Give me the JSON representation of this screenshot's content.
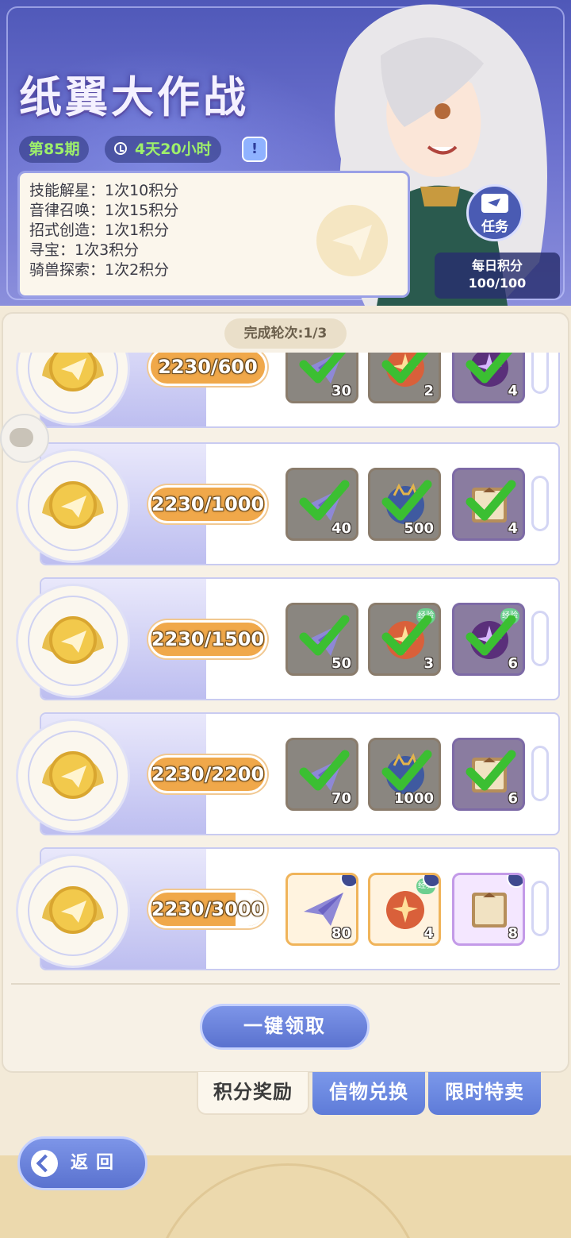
{
  "event": {
    "title": "纸翼大作战",
    "issue": "第85期",
    "time_left": "4天20小时",
    "rules": [
      "技能解星：1次10积分",
      "音律召唤：1次15积分",
      "招式创造：1次1积分",
      "寻宝：1次3积分",
      "骑兽探索：1次2积分"
    ],
    "task_label": "任务",
    "daily_label": "每日积分",
    "daily_value": "100/100"
  },
  "panel": {
    "round_label": "完成轮次:1/3",
    "claim_all": "一键领取"
  },
  "rewards": [
    {
      "progress": "2230/600",
      "fill": 1.0,
      "items": [
        {
          "icon": "paper-plane-icon",
          "count": "30",
          "claimed": true,
          "purple": false
        },
        {
          "icon": "orange-spirit-icon",
          "count": "2",
          "claimed": true,
          "purple": false
        },
        {
          "icon": "purple-spirit-icon",
          "count": "4",
          "claimed": true,
          "purple": true
        }
      ]
    },
    {
      "progress": "2230/1000",
      "fill": 1.0,
      "items": [
        {
          "icon": "paper-plane-icon",
          "count": "40",
          "claimed": true,
          "purple": false
        },
        {
          "icon": "blue-cat-orb-icon",
          "count": "500",
          "claimed": true,
          "purple": false
        },
        {
          "icon": "recipe-book-icon",
          "count": "4",
          "claimed": true,
          "purple": true
        }
      ]
    },
    {
      "progress": "2230/1500",
      "fill": 1.0,
      "items": [
        {
          "icon": "paper-plane-icon",
          "count": "50",
          "claimed": true,
          "purple": false
        },
        {
          "icon": "orange-spirit-exp-icon",
          "count": "3",
          "claimed": true,
          "purple": false,
          "exp": "经验"
        },
        {
          "icon": "purple-spirit-exp-icon",
          "count": "6",
          "claimed": true,
          "purple": true,
          "exp": "经验"
        }
      ]
    },
    {
      "progress": "2230/2200",
      "fill": 1.0,
      "items": [
        {
          "icon": "paper-plane-icon",
          "count": "70",
          "claimed": true,
          "purple": false
        },
        {
          "icon": "blue-cat-orb-icon",
          "count": "1000",
          "claimed": true,
          "purple": false
        },
        {
          "icon": "recipe-book-icon",
          "count": "6",
          "claimed": true,
          "purple": true
        }
      ]
    },
    {
      "progress": "2230/3000",
      "fill": 0.74,
      "items": [
        {
          "icon": "paper-plane-icon",
          "count": "80",
          "claimed": false,
          "purple": false
        },
        {
          "icon": "orange-spirit-exp-icon",
          "count": "4",
          "claimed": false,
          "purple": false,
          "exp": "经验"
        },
        {
          "icon": "recipe-book-icon",
          "count": "8",
          "claimed": false,
          "purple": true
        }
      ]
    }
  ],
  "tabs": [
    "积分奖励",
    "信物兑换",
    "限时特卖"
  ],
  "back_label": "返回",
  "colors": {
    "accent": "#5a72cf",
    "progress": "#f0a84a",
    "check": "#4ccd3c"
  }
}
